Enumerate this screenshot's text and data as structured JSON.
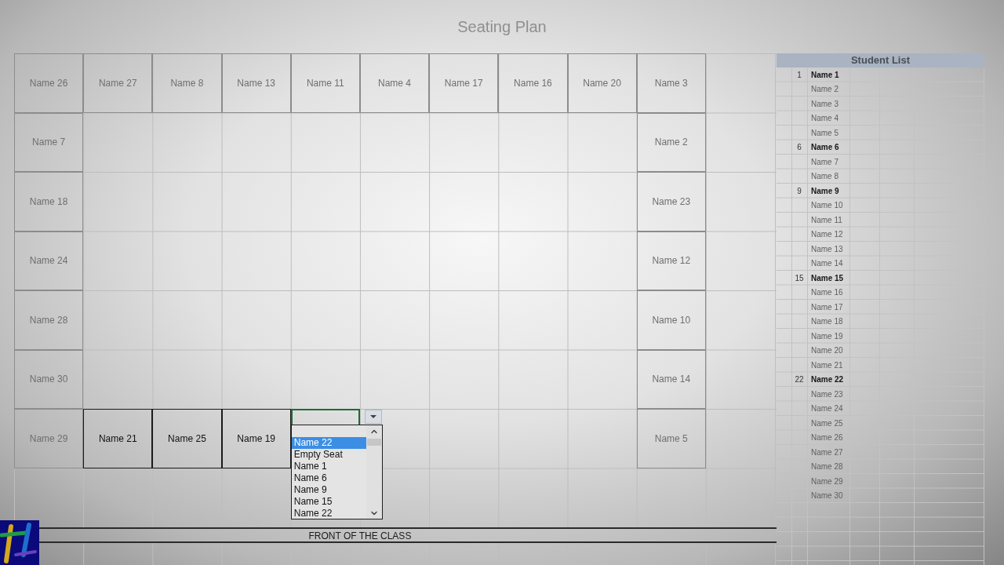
{
  "title": "Seating Plan",
  "seating_grid": {
    "rows": [
      {
        "seats": [
          {
            "kind": "seat",
            "name": "Name 26"
          },
          {
            "kind": "seat",
            "name": "Name 27"
          },
          {
            "kind": "seat",
            "name": "Name 8"
          },
          {
            "kind": "seat",
            "name": "Name 13"
          },
          {
            "kind": "seat",
            "name": "Name 11"
          },
          {
            "kind": "seat",
            "name": "Name 4"
          },
          {
            "kind": "seat",
            "name": "Name 17"
          },
          {
            "kind": "seat",
            "name": "Name 16"
          },
          {
            "kind": "seat",
            "name": "Name 20"
          },
          {
            "kind": "seat",
            "name": "Name 3"
          },
          {
            "kind": "empty"
          }
        ]
      },
      {
        "seats": [
          {
            "kind": "seat",
            "name": "Name 7"
          },
          {
            "kind": "empty"
          },
          {
            "kind": "empty"
          },
          {
            "kind": "empty"
          },
          {
            "kind": "empty"
          },
          {
            "kind": "empty"
          },
          {
            "kind": "empty"
          },
          {
            "kind": "empty"
          },
          {
            "kind": "empty"
          },
          {
            "kind": "seat",
            "name": "Name 2"
          },
          {
            "kind": "empty"
          }
        ]
      },
      {
        "seats": [
          {
            "kind": "seat",
            "name": "Name 18"
          },
          {
            "kind": "empty"
          },
          {
            "kind": "empty"
          },
          {
            "kind": "empty"
          },
          {
            "kind": "empty"
          },
          {
            "kind": "empty"
          },
          {
            "kind": "empty"
          },
          {
            "kind": "empty"
          },
          {
            "kind": "empty"
          },
          {
            "kind": "seat",
            "name": "Name 23"
          },
          {
            "kind": "empty"
          }
        ]
      },
      {
        "seats": [
          {
            "kind": "seat",
            "name": "Name 24"
          },
          {
            "kind": "empty"
          },
          {
            "kind": "empty"
          },
          {
            "kind": "empty"
          },
          {
            "kind": "empty"
          },
          {
            "kind": "empty"
          },
          {
            "kind": "empty"
          },
          {
            "kind": "empty"
          },
          {
            "kind": "empty"
          },
          {
            "kind": "seat",
            "name": "Name 12"
          },
          {
            "kind": "empty"
          }
        ]
      },
      {
        "seats": [
          {
            "kind": "seat",
            "name": "Name 28"
          },
          {
            "kind": "empty"
          },
          {
            "kind": "empty"
          },
          {
            "kind": "empty"
          },
          {
            "kind": "empty"
          },
          {
            "kind": "empty"
          },
          {
            "kind": "empty"
          },
          {
            "kind": "empty"
          },
          {
            "kind": "empty"
          },
          {
            "kind": "seat",
            "name": "Name 10"
          },
          {
            "kind": "empty"
          }
        ]
      },
      {
        "seats": [
          {
            "kind": "seat",
            "name": "Name 30"
          },
          {
            "kind": "empty"
          },
          {
            "kind": "empty"
          },
          {
            "kind": "empty"
          },
          {
            "kind": "empty"
          },
          {
            "kind": "empty"
          },
          {
            "kind": "empty"
          },
          {
            "kind": "empty"
          },
          {
            "kind": "empty"
          },
          {
            "kind": "seat",
            "name": "Name 14"
          },
          {
            "kind": "empty"
          }
        ]
      },
      {
        "seats": [
          {
            "kind": "seat",
            "name": "Name 29"
          },
          {
            "kind": "seat",
            "name": "Name 21"
          },
          {
            "kind": "seat",
            "name": "Name 25"
          },
          {
            "kind": "seat",
            "name": "Name 19"
          },
          {
            "kind": "active"
          },
          {
            "kind": "empty"
          },
          {
            "kind": "empty"
          },
          {
            "kind": "empty"
          },
          {
            "kind": "empty"
          },
          {
            "kind": "seat",
            "name": "Name 5"
          },
          {
            "kind": "empty"
          }
        ]
      },
      {
        "seats": [
          {
            "kind": "empty"
          },
          {
            "kind": "empty"
          },
          {
            "kind": "empty"
          },
          {
            "kind": "empty"
          },
          {
            "kind": "empty"
          },
          {
            "kind": "empty"
          },
          {
            "kind": "empty"
          },
          {
            "kind": "empty"
          },
          {
            "kind": "empty"
          },
          {
            "kind": "empty"
          },
          {
            "kind": "empty"
          }
        ]
      }
    ]
  },
  "dropdown": {
    "items": [
      {
        "label": "Name 22",
        "selected": true
      },
      {
        "label": "Empty Seat",
        "selected": false
      },
      {
        "label": "Name 1",
        "selected": false
      },
      {
        "label": "Name 6",
        "selected": false
      },
      {
        "label": "Name 9",
        "selected": false
      },
      {
        "label": "Name 15",
        "selected": false
      },
      {
        "label": "Name 22",
        "selected": false
      }
    ]
  },
  "front_label": "FRONT OF THE CLASS",
  "student_list": {
    "title": "Student List",
    "rows": [
      {
        "number": "1",
        "name": "Name 1",
        "seated": false
      },
      {
        "name": "Name 2",
        "seated": true
      },
      {
        "name": "Name 3",
        "seated": true
      },
      {
        "name": "Name 4",
        "seated": true
      },
      {
        "name": "Name 5",
        "seated": true
      },
      {
        "number": "6",
        "name": "Name 6",
        "seated": false
      },
      {
        "name": "Name 7",
        "seated": true
      },
      {
        "name": "Name 8",
        "seated": true
      },
      {
        "number": "9",
        "name": "Name 9",
        "seated": false
      },
      {
        "name": "Name 10",
        "seated": true
      },
      {
        "name": "Name 11",
        "seated": true
      },
      {
        "name": "Name 12",
        "seated": true
      },
      {
        "name": "Name 13",
        "seated": true
      },
      {
        "name": "Name 14",
        "seated": true
      },
      {
        "number": "15",
        "name": "Name 15",
        "seated": false
      },
      {
        "name": "Name 16",
        "seated": true
      },
      {
        "name": "Name 17",
        "seated": true
      },
      {
        "name": "Name 18",
        "seated": true
      },
      {
        "name": "Name 19",
        "seated": true
      },
      {
        "name": "Name 20",
        "seated": true
      },
      {
        "name": "Name 21",
        "seated": true
      },
      {
        "number": "22",
        "name": "Name 22",
        "seated": false
      },
      {
        "name": "Name 23",
        "seated": true
      },
      {
        "name": "Name 24",
        "seated": true
      },
      {
        "name": "Name 25",
        "seated": true
      },
      {
        "name": "Name 26",
        "seated": true
      },
      {
        "name": "Name 27",
        "seated": true
      },
      {
        "name": "Name 28",
        "seated": true
      },
      {
        "name": "Name 29",
        "seated": true
      },
      {
        "name": "Name 30",
        "seated": true
      }
    ]
  }
}
